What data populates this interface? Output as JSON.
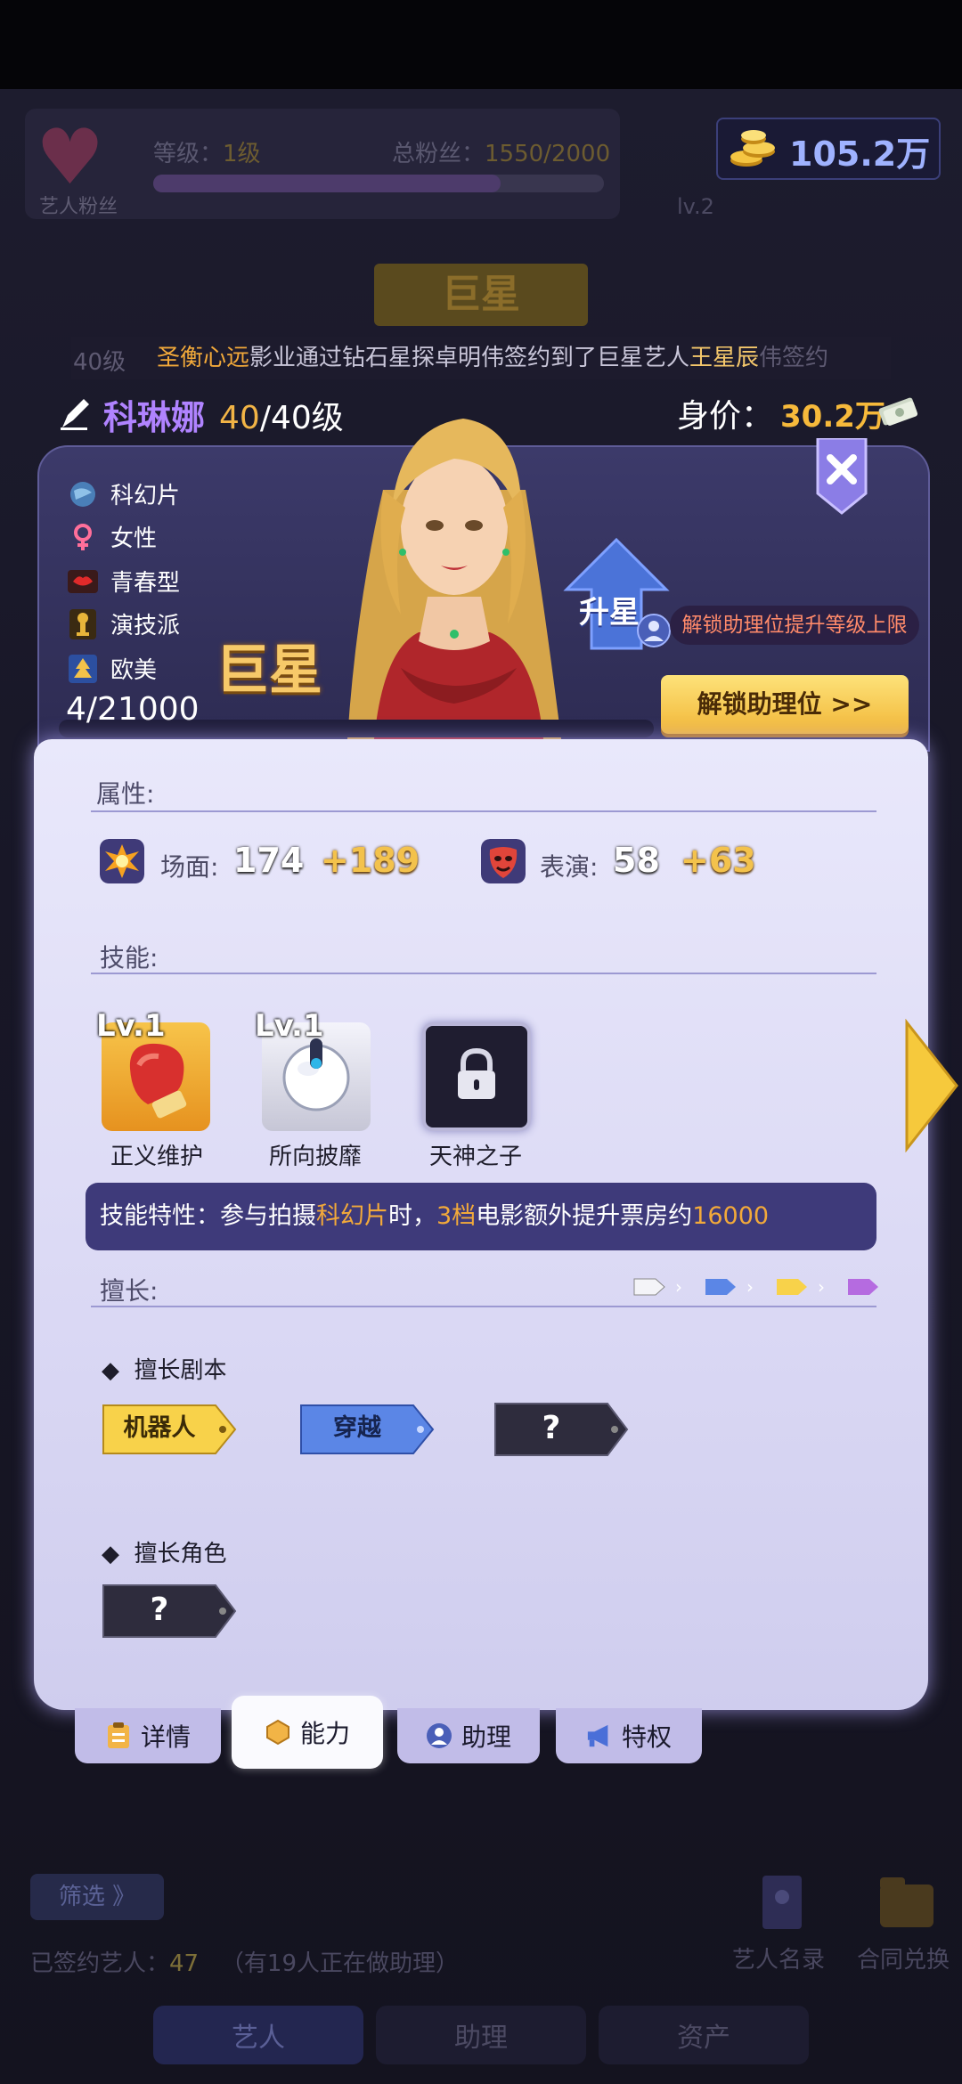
{
  "header": {
    "fan_panel_label": "艺人粉丝",
    "level_label": "等级：",
    "level_value": "1级",
    "total_fans_label": "总粉丝：",
    "total_fans_value": "1550/2000",
    "studio_level": "lv.2",
    "coins": "105.2万"
  },
  "banner": {
    "title": "巨星"
  },
  "marquee": {
    "prefix": "40级",
    "player": "圣衡心远",
    "mid": "影业通过钻石星探卓明伟签约到了巨星艺人",
    "artist": "王星辰",
    "suffix": "伟签约"
  },
  "artist": {
    "name": "科琳娜",
    "level_current": "40",
    "level_rest": "/40级",
    "worth_label": "身价：",
    "worth_value": "30.2万",
    "rank": "巨星",
    "exp": "4/21000",
    "tags": [
      {
        "icon": "globe-icon",
        "label": "科幻片"
      },
      {
        "icon": "female-icon",
        "label": "女性"
      },
      {
        "icon": "lips-icon",
        "label": "青春型"
      },
      {
        "icon": "trophy-icon",
        "label": "演技派"
      },
      {
        "icon": "tree-icon",
        "label": "欧美"
      }
    ],
    "upstar_label": "升星",
    "unlock_tip": "解锁助理位提升等级上限",
    "unlock_button": "解锁助理位 >>"
  },
  "ability": {
    "attributes_title": "属性:",
    "attributes": [
      {
        "icon": "explosion-icon",
        "name": "场面:",
        "base": "174",
        "bonus": "+189"
      },
      {
        "icon": "mask-icon",
        "name": "表演:",
        "base": "58",
        "bonus": "+63"
      }
    ],
    "skills_title": "技能:",
    "skills": [
      {
        "icon": "boxing-glove-icon",
        "level": "Lv.1",
        "name": "正义维护",
        "locked": false
      },
      {
        "icon": "helmet-ball-icon",
        "level": "Lv.1",
        "name": "所向披靡",
        "locked": false
      },
      {
        "icon": "lock-icon",
        "level": "",
        "name": "天神之子",
        "locked": true
      }
    ],
    "trait": {
      "prefix": "技能特性：参与拍摄",
      "genre": "科幻片",
      "mid1": "时，",
      "grade": "3档",
      "mid2": "电影额外提升票房约",
      "value": "16000"
    },
    "specialty_title": "擅长:",
    "script_title": "擅长剧本",
    "scripts": [
      "机器人",
      "穿越",
      "?"
    ],
    "role_title": "擅长角色",
    "roles": [
      "?"
    ],
    "colors": {
      "yellow": "#f8d24a",
      "blue": "#5b86e6",
      "dark": "#2e2c3d",
      "purple": "#b56be0"
    }
  },
  "tabs": [
    {
      "icon": "clipboard-icon",
      "label": "详情",
      "active": false
    },
    {
      "icon": "hexagon-icon",
      "label": "能力",
      "active": true
    },
    {
      "icon": "assistant-icon",
      "label": "助理",
      "active": false
    },
    {
      "icon": "megaphone-icon",
      "label": "特权",
      "active": false
    }
  ],
  "footer": {
    "filter": "筛选 》",
    "signed_label": "已签约艺人：",
    "signed_count": "47",
    "signed_note": "（有19人正在做助理）",
    "roster": "艺人名录",
    "contract": "合同兑换",
    "nav": [
      "艺人",
      "助理",
      "资产"
    ]
  }
}
